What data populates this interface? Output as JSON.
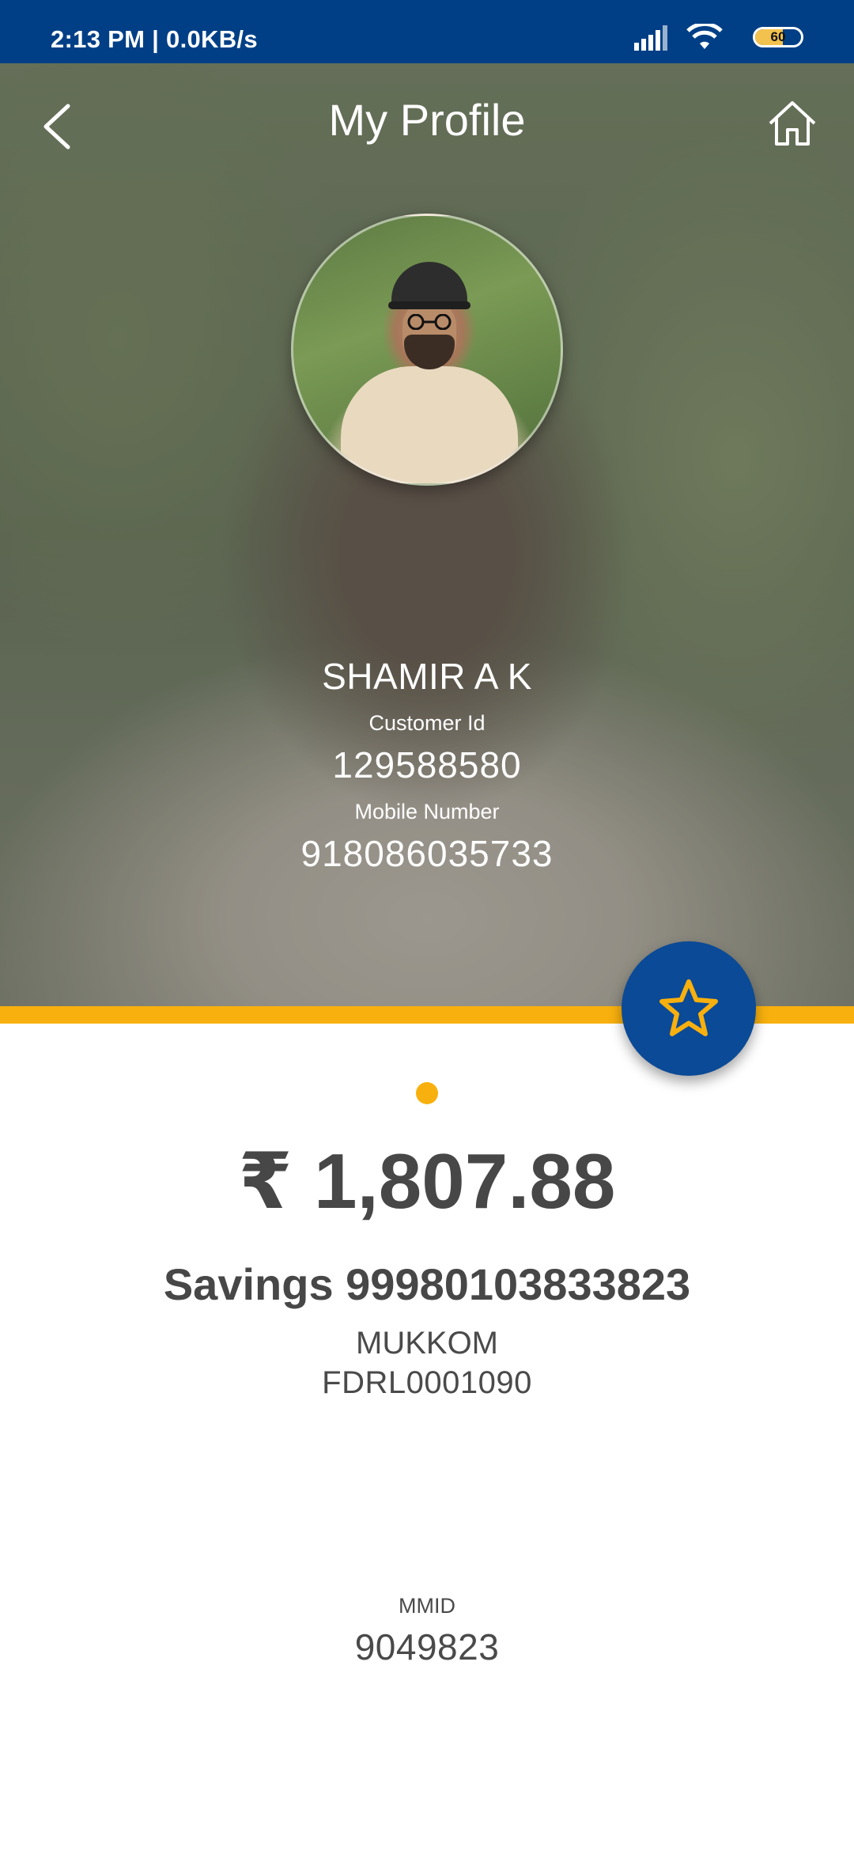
{
  "status_bar": {
    "time_speed": "2:13 PM | 0.0KB/s",
    "battery_level": "60",
    "battery_fraction": 0.6,
    "battery_color": "#f2c14e"
  },
  "header": {
    "title": "My Profile",
    "back_icon": "chevron-left-icon",
    "home_icon": "home-icon"
  },
  "profile": {
    "name": "SHAMIR A K",
    "customer_id_label": "Customer Id",
    "customer_id": "129588580",
    "mobile_label": "Mobile Number",
    "mobile": "918086035733"
  },
  "favorite": {
    "icon": "star-icon"
  },
  "account": {
    "balance": "₹ 1,807.88",
    "type_number": "Savings 99980103833823",
    "branch": "MUKKOM",
    "ifsc": "FDRL0001090",
    "mmid_label": "MMID",
    "mmid": "9049823"
  },
  "colors": {
    "status_bar": "#003f86",
    "accent": "#f8b00e",
    "fab": "#0b4a96",
    "text_dark": "#474747"
  }
}
